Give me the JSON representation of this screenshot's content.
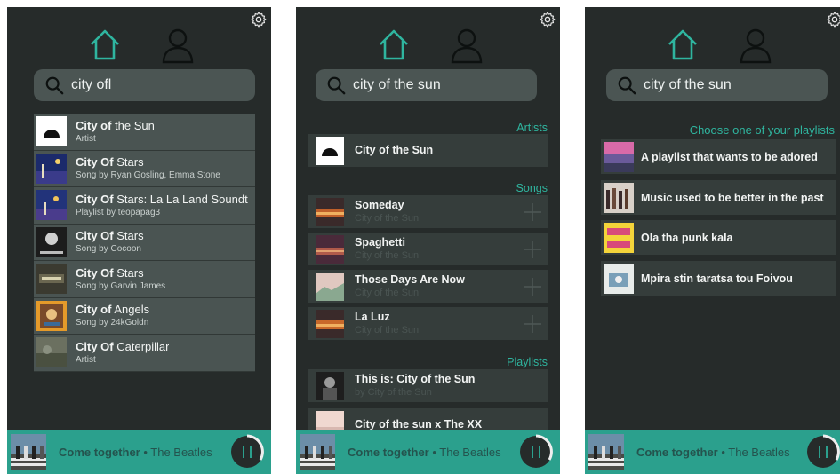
{
  "colors": {
    "background": "#262b2a",
    "accent": "#2fb59f",
    "player": "#2ba08d",
    "item": "#4a5452"
  },
  "icons": {
    "home": "home-icon",
    "profile": "user-icon",
    "settings": "gear-icon",
    "search": "search-icon",
    "add": "plus-icon",
    "pause": "pause-icon"
  },
  "player": {
    "song": "Come together",
    "separator": " • ",
    "artist": "The Beatles"
  },
  "screen1": {
    "search_value": "city ofl",
    "results": [
      {
        "bold": "City of",
        "rest": " the Sun",
        "sub": "Artist"
      },
      {
        "bold": "City Of",
        "rest": " Stars",
        "sub": "Song by Ryan Gosling, Emma Stone"
      },
      {
        "bold": "City Of",
        "rest": " Stars: La La Land Soundt",
        "sub": "Playlist by teopapag3"
      },
      {
        "bold": "City Of",
        "rest": " Stars",
        "sub": "Song by Cocoon"
      },
      {
        "bold": "City Of",
        "rest": " Stars",
        "sub": "Song by Garvin James"
      },
      {
        "bold": "City of",
        "rest": " Angels",
        "sub": "Song by 24kGoldn"
      },
      {
        "bold": "City Of",
        "rest": " Caterpillar",
        "sub": "Artist"
      }
    ]
  },
  "screen2": {
    "search_value": "city of the sun",
    "artists_heading": "Artists",
    "artist": "City of the Sun",
    "songs_heading": "Songs",
    "songs": [
      {
        "title": "Someday",
        "sub": "City of the Sun"
      },
      {
        "title": "Spaghetti",
        "sub": "City of the Sun"
      },
      {
        "title": "Those Days Are Now",
        "sub": "City of the Sun"
      },
      {
        "title": "La Luz",
        "sub": "City of the Sun"
      }
    ],
    "playlists_heading": "Playlists",
    "playlists": [
      {
        "title": "This is: City of the Sun",
        "sub": "by City of the Sun"
      },
      {
        "title": "City of the sun x The XX",
        "sub": ""
      }
    ]
  },
  "screen3": {
    "search_value": "city of the sun",
    "heading": "Choose one of your playlists",
    "playlists": [
      "A playlist that wants to be adored",
      "Music used to be better in the past",
      "Ola tha punk kala",
      "Mpira stin taratsa tou Foivou"
    ]
  }
}
